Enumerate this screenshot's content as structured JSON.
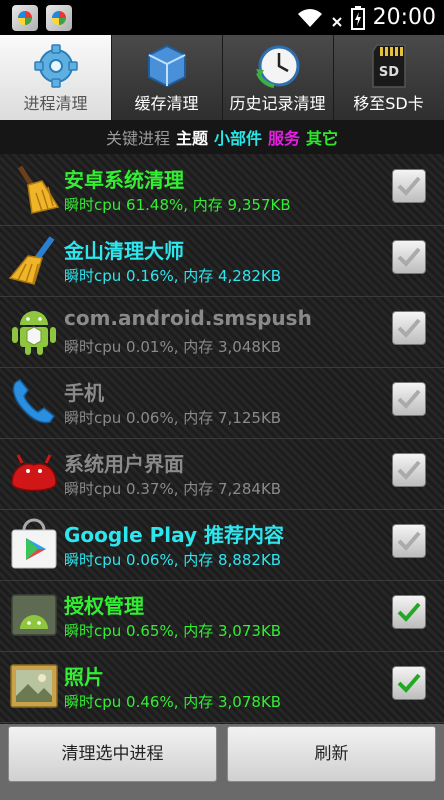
{
  "status_bar": {
    "time": "20:00",
    "signal_icon": "wifi-icon",
    "battery_icon": "battery-icon"
  },
  "tabs": [
    {
      "label": "进程清理",
      "icon": "gear-icon",
      "active": true
    },
    {
      "label": "缓存清理",
      "icon": "cube-icon",
      "active": false
    },
    {
      "label": "历史记录清理",
      "icon": "clock-icon",
      "active": false
    },
    {
      "label": "移至SD卡",
      "icon": "sd-card-icon",
      "active": false
    }
  ],
  "categories": [
    {
      "label": "关键进程",
      "color": "#9a9a9a"
    },
    {
      "label": "主题",
      "color": "#ffffff"
    },
    {
      "label": "小部件",
      "color": "#29e6e6"
    },
    {
      "label": "服务",
      "color": "#e61ee6"
    },
    {
      "label": "其它",
      "color": "#2ee82e"
    }
  ],
  "processes": [
    {
      "name": "安卓系统清理",
      "stats": "瞬时cpu 61.48%, 内存 9,357KB",
      "color": "#33ee33",
      "checked": false,
      "icon": "broom-icon"
    },
    {
      "name": "金山清理大师",
      "stats": "瞬时cpu 0.16%, 内存 4,282KB",
      "color": "#2ee6ee",
      "checked": false,
      "icon": "broom-blue-icon"
    },
    {
      "name": "com.android.smspush",
      "stats": "瞬时cpu 0.01%, 内存 3,048KB",
      "color": "#8a8a8a",
      "checked": false,
      "icon": "android-icon"
    },
    {
      "name": "手机",
      "stats": "瞬时cpu 0.06%, 内存 7,125KB",
      "color": "#8a8a8a",
      "checked": false,
      "icon": "phone-icon"
    },
    {
      "name": "系统用户界面",
      "stats": "瞬时cpu 0.37%, 内存 7,284KB",
      "color": "#8a8a8a",
      "checked": false,
      "icon": "jellybean-icon"
    },
    {
      "name": "Google Play 推荐内容",
      "stats": "瞬时cpu 0.06%, 内存 8,882KB",
      "color": "#2ee6ee",
      "checked": false,
      "icon": "play-store-icon"
    },
    {
      "name": "授权管理",
      "stats": "瞬时cpu 0.65%, 内存 3,073KB",
      "color": "#33ee33",
      "checked": true,
      "icon": "android-folder-icon"
    },
    {
      "name": "照片",
      "stats": "瞬时cpu 0.46%, 内存 3,078KB",
      "color": "#33ee33",
      "checked": true,
      "icon": "photo-icon"
    }
  ],
  "buttons": {
    "clean": "清理选中进程",
    "refresh": "刷新"
  }
}
